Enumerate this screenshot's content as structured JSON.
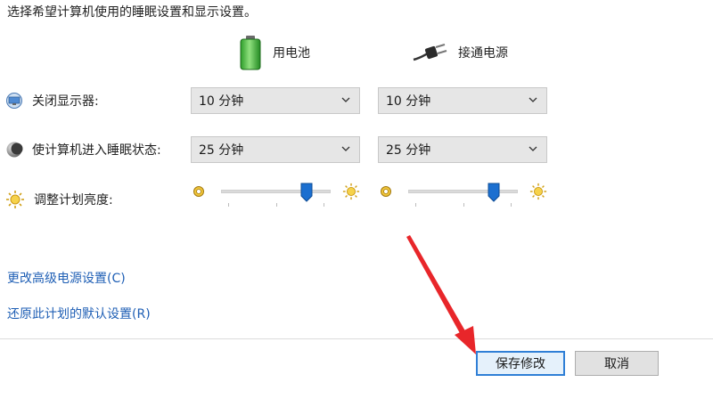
{
  "intro": "选择希望计算机使用的睡眠设置和显示设置。",
  "columns": {
    "battery": "用电池",
    "plugged": "接通电源"
  },
  "rows": {
    "display_off": {
      "label": "关闭显示器:",
      "battery_value": "10 分钟",
      "plugged_value": "10 分钟"
    },
    "sleep": {
      "label": "使计算机进入睡眠状态:",
      "battery_value": "25 分钟",
      "plugged_value": "25 分钟"
    },
    "brightness": {
      "label": "调整计划亮度:",
      "battery_level": 0.78,
      "plugged_level": 0.78
    }
  },
  "links": {
    "advanced": "更改高级电源设置(C)",
    "restore": "还原此计划的默认设置(R)"
  },
  "buttons": {
    "save": "保存修改",
    "cancel": "取消"
  },
  "colors": {
    "link": "#1f5fb5",
    "slider_thumb": "#1b6fd0",
    "annotation_arrow": "#e8262a",
    "default_button_border": "#2f7fd6"
  },
  "icons": {
    "battery": "battery-icon",
    "plugged": "power-plug-icon",
    "display": "monitor-icon",
    "sleep": "moon-icon",
    "brightness": "sun-icon"
  }
}
